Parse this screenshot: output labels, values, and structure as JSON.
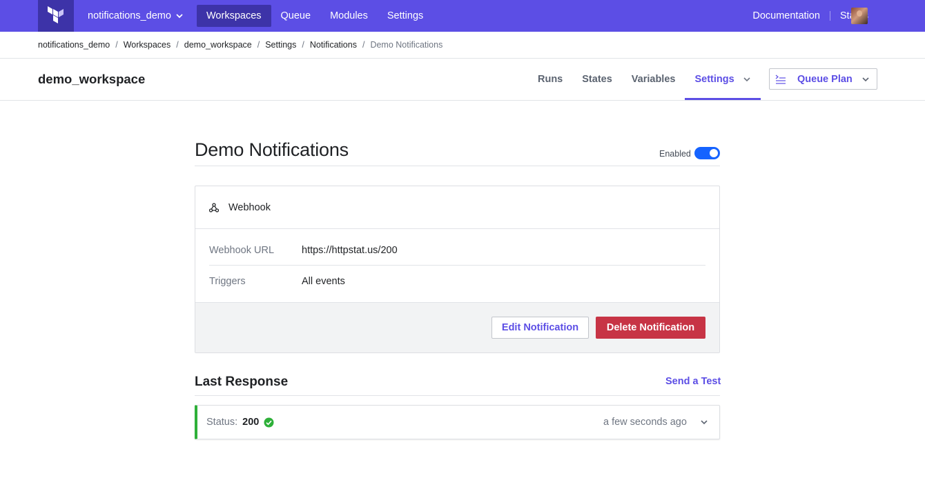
{
  "topnav": {
    "org": "notifications_demo",
    "links": [
      "Workspaces",
      "Queue",
      "Modules",
      "Settings"
    ],
    "active": "Workspaces",
    "documentation": "Documentation",
    "status": "Status",
    "brand_color": "#5c4ee5"
  },
  "breadcrumbs": [
    "notifications_demo",
    "Workspaces",
    "demo_workspace",
    "Settings",
    "Notifications",
    "Demo Notifications"
  ],
  "workspace": {
    "title": "demo_workspace",
    "tabs": [
      "Runs",
      "States",
      "Variables",
      "Settings"
    ],
    "active_tab": "Settings",
    "queue_button": "Queue Plan"
  },
  "notification": {
    "title": "Demo Notifications",
    "enabled_label": "Enabled",
    "enabled": true,
    "destination_type": "Webhook",
    "fields": [
      {
        "label": "Webhook URL",
        "value": "https://httpstat.us/200"
      },
      {
        "label": "Triggers",
        "value": "All events"
      }
    ],
    "edit_button": "Edit Notification",
    "delete_button": "Delete Notification"
  },
  "last_response": {
    "title": "Last Response",
    "send_test": "Send a Test",
    "status_label": "Status:",
    "status_code": "200",
    "time": "a few seconds ago",
    "success_color": "#2eb039"
  }
}
